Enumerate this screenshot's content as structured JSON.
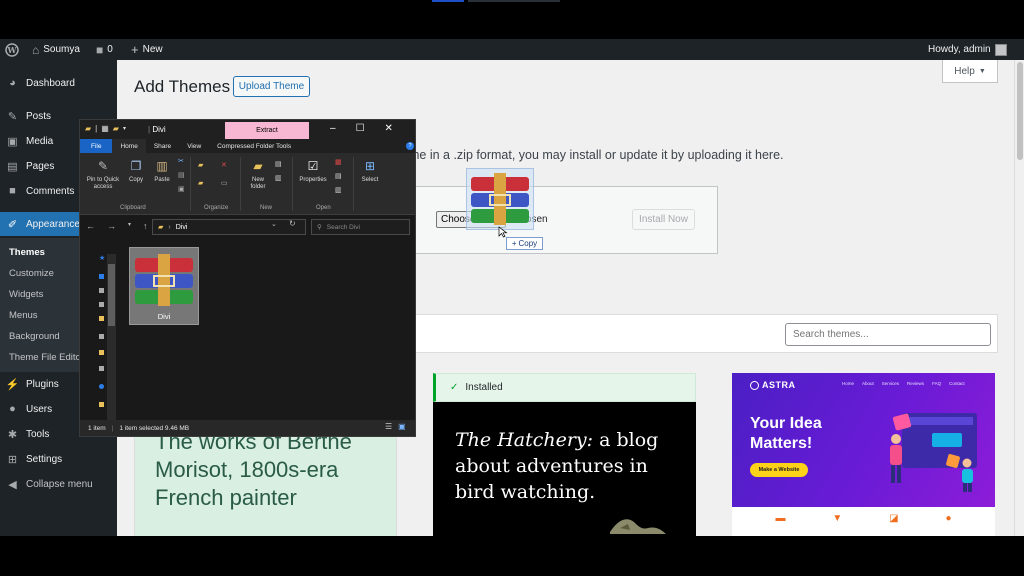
{
  "admin_bar": {
    "site_name": "Soumya",
    "comments_count": "0",
    "new_label": "New",
    "howdy": "Howdy, admin"
  },
  "sidebar": {
    "items": [
      {
        "label": "Dashboard",
        "icon": "dashboard-icon"
      },
      {
        "label": "Posts",
        "icon": "pin-icon"
      },
      {
        "label": "Media",
        "icon": "media-icon"
      },
      {
        "label": "Pages",
        "icon": "page-icon"
      },
      {
        "label": "Comments",
        "icon": "comment-icon"
      },
      {
        "label": "Appearance",
        "icon": "brush-icon"
      },
      {
        "label": "Plugins",
        "icon": "plug-icon"
      },
      {
        "label": "Users",
        "icon": "user-icon"
      },
      {
        "label": "Tools",
        "icon": "wrench-icon"
      },
      {
        "label": "Settings",
        "icon": "settings-icon"
      },
      {
        "label": "Collapse menu",
        "icon": "collapse-icon"
      }
    ],
    "submenu": [
      "Themes",
      "Customize",
      "Widgets",
      "Menus",
      "Background",
      "Theme File Edito"
    ]
  },
  "content": {
    "title": "Add Themes",
    "upload_button": "Upload Theme",
    "help_label": "Help",
    "upload_desc": "me in a .zip format, you may install or update it by uploading it here.",
    "choose_label": "Choose File",
    "no_file_suffix": "e chosen",
    "install_label": "Install Now",
    "search_placeholder": "Search themes..."
  },
  "themes": {
    "card1_text": "The works of Berthe Morisot, 1800s-era French painter",
    "card2_installed": "Installed",
    "card2_em": "The Hatchery:",
    "card2_rest": " a blog about adventures in bird watching.",
    "card3": {
      "logo": "ASTRA",
      "nav": [
        "Home",
        "About",
        "Services",
        "Reviews",
        "FAQ",
        "Contact"
      ],
      "headline": "Your Idea Matters!",
      "button": "Make a Website"
    }
  },
  "drag": {
    "copy_label": "Copy"
  },
  "explorer": {
    "title": "Divi",
    "extract_tab": "Extract",
    "tabs": [
      "File",
      "Home",
      "Share",
      "View",
      "Compressed Folder Tools"
    ],
    "ribbon": {
      "pin_label": "Pin to Quick access",
      "copy": "Copy",
      "paste": "Paste",
      "new_folder": "New folder",
      "properties": "Properties",
      "select": "Select",
      "groups": [
        "Clipboard",
        "Organize",
        "New",
        "Open"
      ]
    },
    "path": "Divi",
    "search_placeholder": "Search Divi",
    "file_name": "Divi",
    "status_items": "1 item",
    "status_selected": "1 item selected  9.46 MB"
  },
  "colors": {
    "wp_dark": "#1d2327",
    "wp_blue": "#2271b1",
    "installed_green": "#00a32a",
    "astra_purple": "#5b1fd0",
    "extract_pink": "#f7b7d3"
  }
}
